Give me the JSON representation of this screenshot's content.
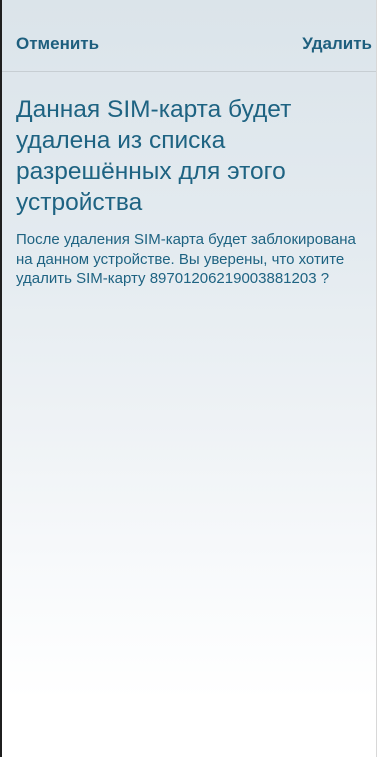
{
  "header": {
    "cancel_label": "Отменить",
    "delete_label": "Удалить"
  },
  "dialog": {
    "title": "Данная SIM-карта будет удалена из списка разрешённых для этого устройства",
    "description": "После удаления SIM-карта будет заблокирована на данном устройстве. Вы уверены, что хотите удалить SIM-карту 89701206219003881203 ?"
  },
  "colors": {
    "accent": "#1e6382",
    "background_top": "#dbe4ea",
    "background_bottom": "#ffffff"
  }
}
